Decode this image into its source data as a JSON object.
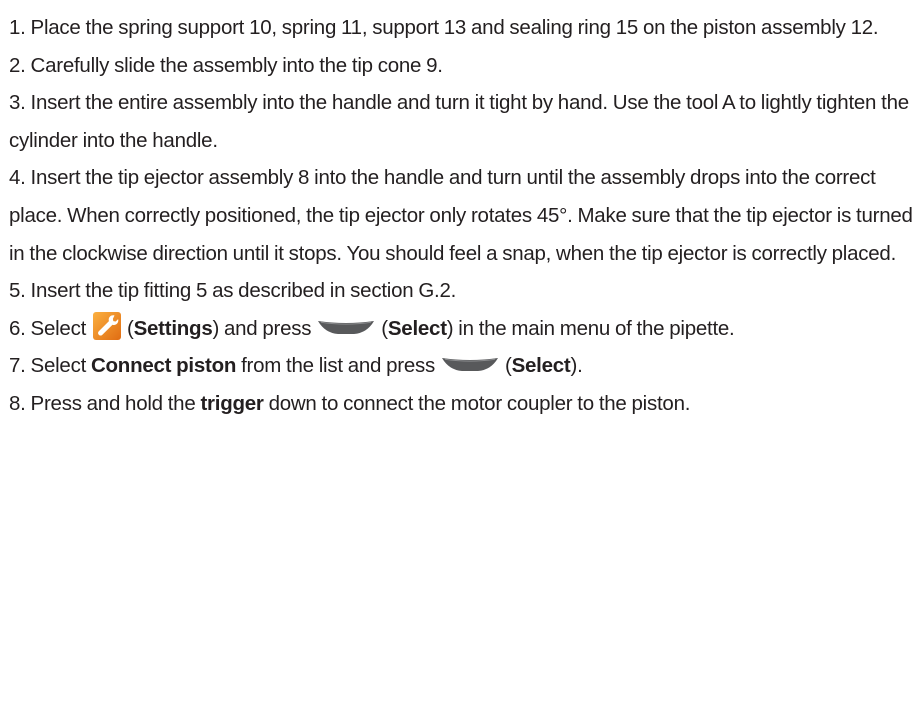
{
  "steps": [
    {
      "text": "1.  Place the spring support 10, spring 11, support 13 and sealing ring 15 on the piston assembly 12."
    },
    {
      "text": "2.  Carefully slide the assembly into the tip cone 9."
    },
    {
      "text": "3.  Insert the entire assembly into the handle and turn it tight by hand. Use the tool A to lightly tighten the cylinder into the handle."
    },
    {
      "text": "4.  Insert the tip ejector assembly 8 into the handle and turn until the assembly drops into the correct place. When correctly positioned, the tip ejector only rotates 45°. Make sure that the tip ejector is turned in the clockwise direction until it stops. You should feel a snap, when the tip ejector is correctly placed."
    },
    {
      "text": "5.  Insert the tip fitting 5 as described in section G.2."
    },
    {
      "prefix": "6.  Select",
      "icon1": "settings-wrench-icon",
      "paren1_open": "(",
      "bold1": "Settings",
      "paren1_close": ") and press",
      "icon2": "select-key-icon",
      "paren2_open": "(",
      "bold2": "Select",
      "suffix": ") in the main menu of the pipette."
    },
    {
      "prefix": "7.  Select ",
      "bold1": "Connect piston",
      "middle": " from the list and press",
      "icon": "select-key-icon",
      "paren_open": "(",
      "bold2": "Select",
      "suffix": ")."
    },
    {
      "prefix": "8.  Press and hold the ",
      "bold": "trigger",
      "suffix": " down to connect the motor coupler to the piston."
    }
  ],
  "colors": {
    "text": "#231f20",
    "wrench_orange": "#f7941d",
    "key_gray": "#58595b"
  }
}
